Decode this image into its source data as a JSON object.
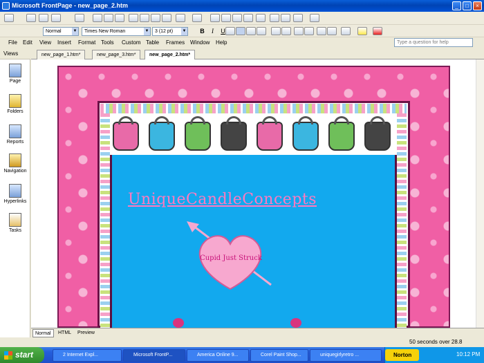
{
  "window": {
    "title": "Microsoft FrontPage - new_page_2.htm",
    "min": "_",
    "max": "□",
    "close": "×"
  },
  "toolbar": {
    "style": "Normal",
    "font": "Times New Roman",
    "size": "3  (12 pt)",
    "bold": "B",
    "italic": "I",
    "underline": "U"
  },
  "menu": [
    "File",
    "Edit",
    "View",
    "Insert",
    "Format",
    "Tools",
    "Custom",
    "Table",
    "Frames",
    "Window",
    "Help"
  ],
  "help_placeholder": "Type a question for help",
  "views": {
    "header": "Views",
    "items": [
      "Page",
      "Folders",
      "Reports",
      "Navigation",
      "Hyperlinks",
      "Tasks"
    ]
  },
  "tabs": [
    "new_page_1.htm*",
    "new_page_3.htm*",
    "new_page_2.htm*"
  ],
  "page": {
    "site_title": "UniqueCandleConcepts",
    "heart_text": "Cupid Just Struck"
  },
  "modes": [
    "Normal",
    "HTML",
    "Preview"
  ],
  "status": "50 seconds over 28.8",
  "taskbar": {
    "start": "start",
    "tasks": [
      "2 Internet Expl...",
      "Microsoft FrontP...",
      "America Online 9...",
      "Corel Paint Shop...",
      "uniquegirlyretro ..."
    ],
    "norton": "Norton",
    "clock": "10:12 PM"
  },
  "colors": {
    "pink": "#F05FA5",
    "content_bg": "#12A9EE",
    "title_pink": "#FF7AC0"
  }
}
